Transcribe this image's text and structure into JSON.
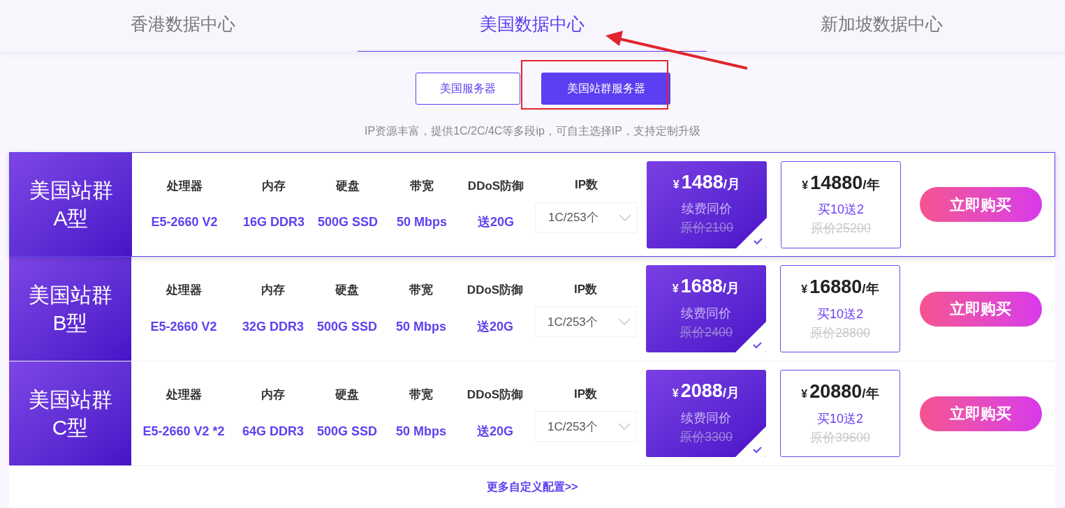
{
  "tabs": [
    {
      "label": "香港数据中心",
      "selected": false
    },
    {
      "label": "美国数据中心",
      "selected": true
    },
    {
      "label": "新加坡数据中心",
      "selected": false
    }
  ],
  "subtabs": [
    {
      "label": "美国服务器",
      "selected": false
    },
    {
      "label": "美国站群服务器",
      "selected": true
    }
  ],
  "description": "IP资源丰富，提供1C/2C/4C等多段ip，可自主选择IP，支持定制升级",
  "plans": [
    {
      "name": "美国站群A型",
      "selected": true,
      "specs": [
        {
          "label": "处理器",
          "value": "E5-2660 V2"
        },
        {
          "label": "内存",
          "value": "16G DDR3"
        },
        {
          "label": "硬盘",
          "value": "500G SSD"
        },
        {
          "label": "带宽",
          "value": "50 Mbps"
        },
        {
          "label": "DDoS防御",
          "value": "送20G"
        }
      ],
      "ip_label": "IP数",
      "ip_value": "1C/253个",
      "prices": [
        {
          "currency": "¥",
          "amount": "1488",
          "unit": "/月",
          "note": "续费同价",
          "original": "原价2100",
          "selected": true
        },
        {
          "currency": "¥",
          "amount": "14880",
          "unit": "/年",
          "note": "买10送2",
          "original": "原价25200",
          "selected": false
        }
      ],
      "buy": "立即购买"
    },
    {
      "name": "美国站群B型",
      "selected": false,
      "specs": [
        {
          "label": "处理器",
          "value": "E5-2660 V2"
        },
        {
          "label": "内存",
          "value": "32G DDR3"
        },
        {
          "label": "硬盘",
          "value": "500G SSD"
        },
        {
          "label": "带宽",
          "value": "50 Mbps"
        },
        {
          "label": "DDoS防御",
          "value": "送20G"
        }
      ],
      "ip_label": "IP数",
      "ip_value": "1C/253个",
      "prices": [
        {
          "currency": "¥",
          "amount": "1688",
          "unit": "/月",
          "note": "续费同价",
          "original": "原价2400",
          "selected": true
        },
        {
          "currency": "¥",
          "amount": "16880",
          "unit": "/年",
          "note": "买10送2",
          "original": "原价28800",
          "selected": false
        }
      ],
      "buy": "立即购买"
    },
    {
      "name": "美国站群C型",
      "selected": false,
      "specs": [
        {
          "label": "处理器",
          "value": "E5-2660 V2 *2"
        },
        {
          "label": "内存",
          "value": "64G DDR3"
        },
        {
          "label": "硬盘",
          "value": "500G SSD"
        },
        {
          "label": "带宽",
          "value": "50 Mbps"
        },
        {
          "label": "DDoS防御",
          "value": "送20G"
        }
      ],
      "ip_label": "IP数",
      "ip_value": "1C/253个",
      "prices": [
        {
          "currency": "¥",
          "amount": "2088",
          "unit": "/月",
          "note": "续费同价",
          "original": "原价3300",
          "selected": true
        },
        {
          "currency": "¥",
          "amount": "20880",
          "unit": "/年",
          "note": "买10送2",
          "original": "原价39600",
          "selected": false
        }
      ],
      "buy": "立即购买"
    }
  ],
  "more_link": "更多自定义配置>>"
}
